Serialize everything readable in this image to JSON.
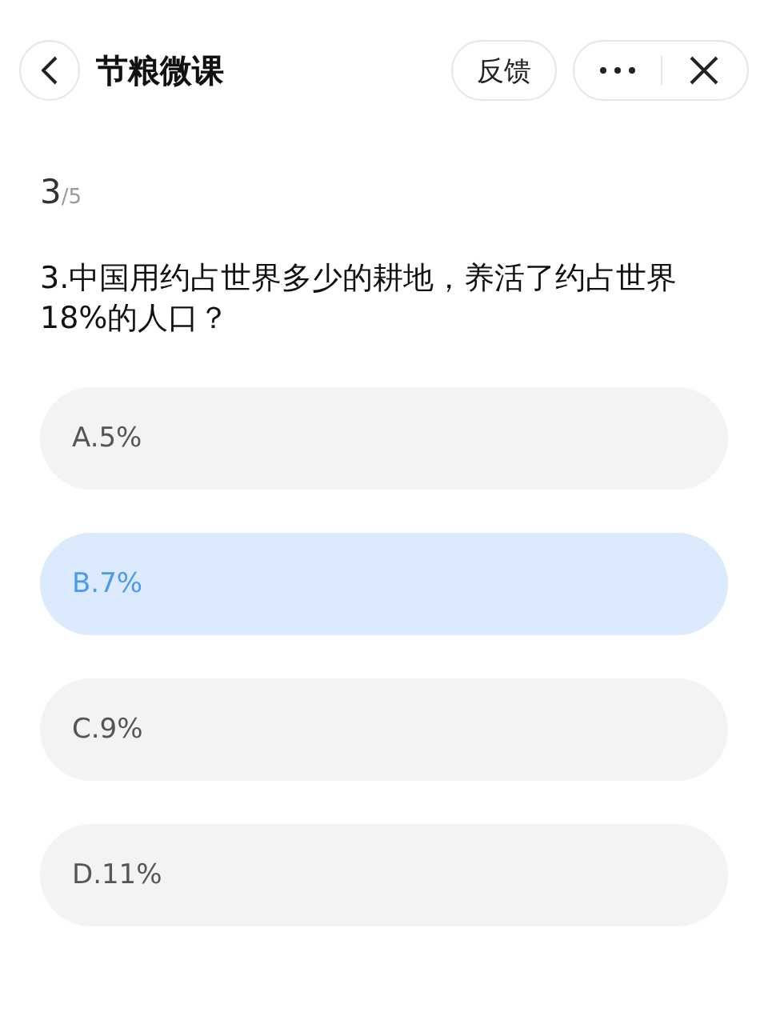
{
  "header": {
    "title": "节粮微课",
    "feedback_button": "反馈"
  },
  "progress": {
    "current": "3",
    "total": "/5"
  },
  "question": "3.中国用约占世界多少的耕地，养活了约占世界18%的人口？",
  "options": [
    {
      "label": "A.5%",
      "selected": false
    },
    {
      "label": "B.7%",
      "selected": true
    },
    {
      "label": "C.9%",
      "selected": false
    },
    {
      "label": "D.11%",
      "selected": false
    }
  ]
}
